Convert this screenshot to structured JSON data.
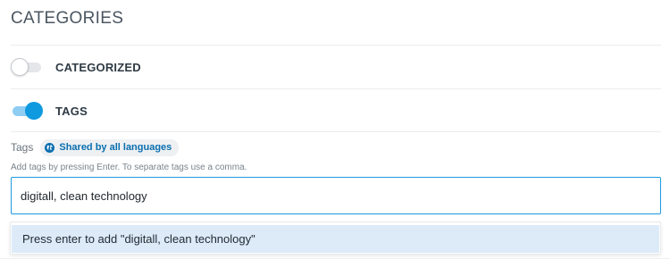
{
  "section": {
    "title": "CATEGORIES"
  },
  "toggles": {
    "categorized": {
      "label": "CATEGORIZED",
      "enabled": false
    },
    "tags": {
      "label": "TAGS",
      "enabled": true
    }
  },
  "tags_field": {
    "label": "Tags",
    "badge": {
      "text": "Shared by all languages",
      "icon": "globe-icon"
    },
    "help": "Add tags by pressing Enter. To separate tags use a comma.",
    "value": "digitall, clean technology"
  },
  "suggestion": {
    "text": "Press enter to add \"digitall, clean technology\""
  },
  "colors": {
    "accent": "#0f9ae0",
    "badge_text": "#0a6fb0",
    "option_highlight": "#ddeaf8"
  }
}
